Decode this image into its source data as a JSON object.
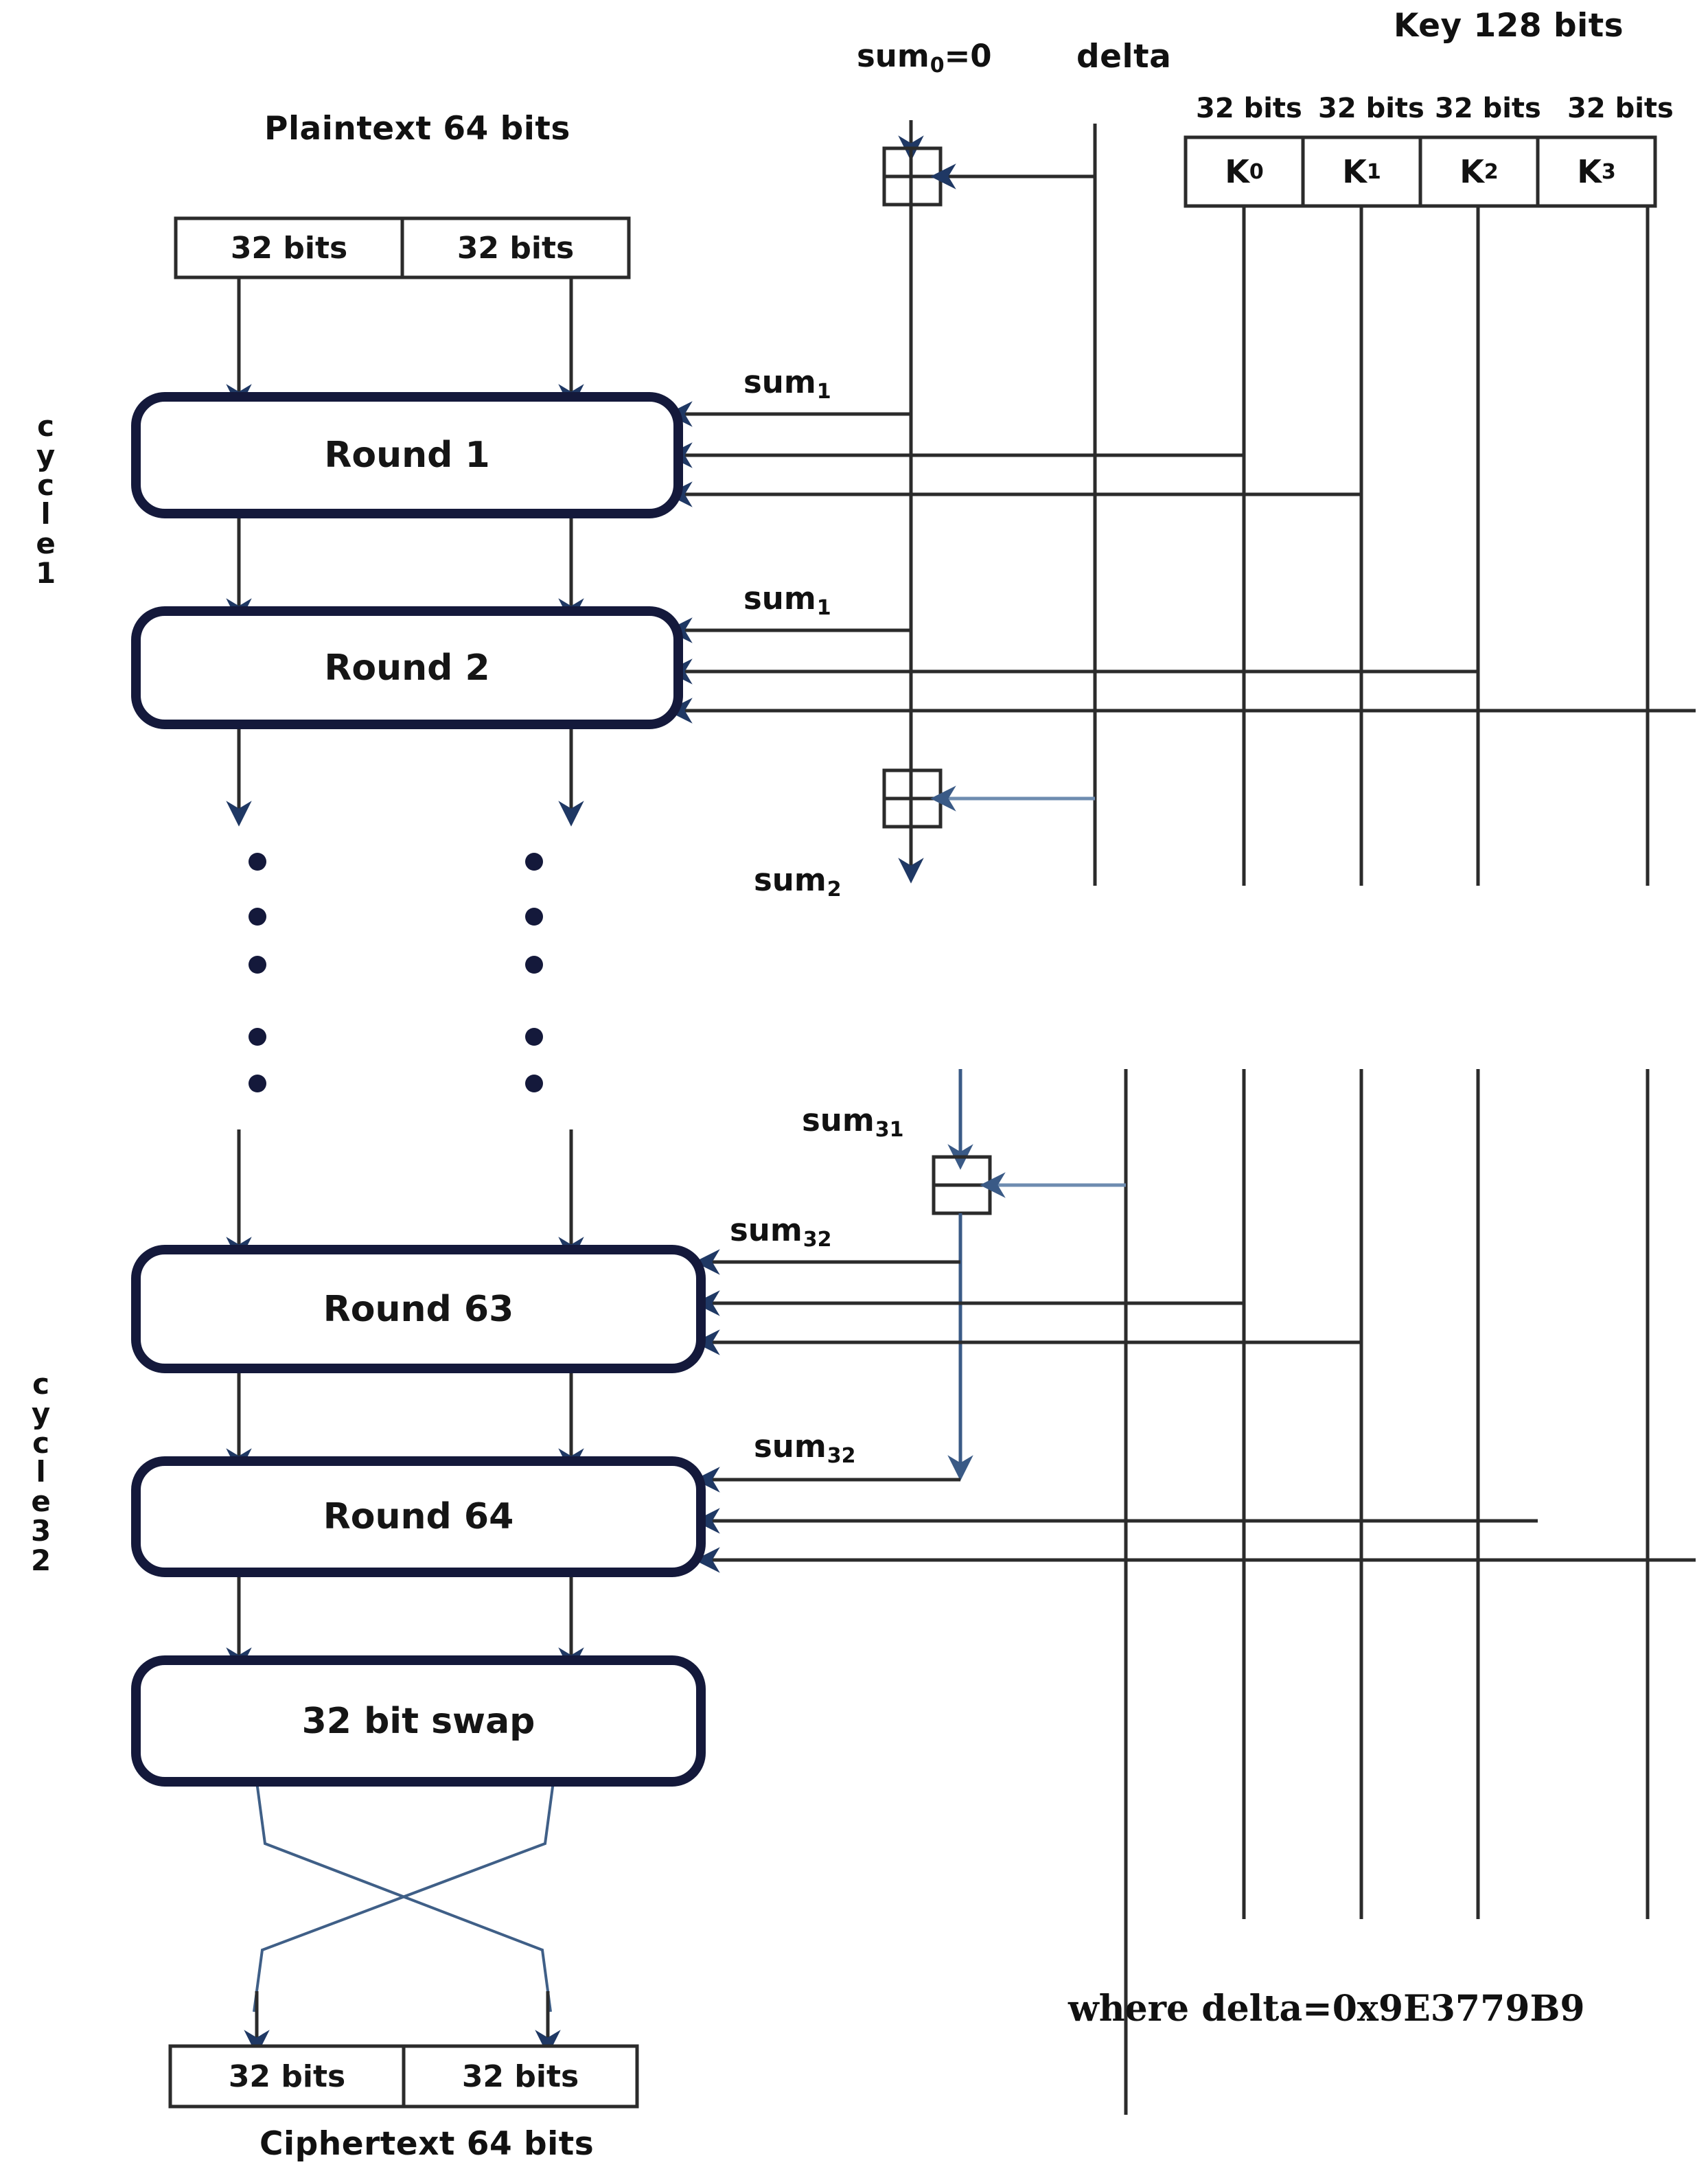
{
  "diagram": {
    "title_plaintext": "Plaintext 64 bits",
    "title_ciphertext": "Ciphertext 64 bits",
    "title_key": "Key 128 bits",
    "label_delta": "delta",
    "label_sum0": "sum",
    "label_sum0_sub": "0",
    "label_sum0_eq": "=0",
    "note_delta_value": "where delta=0x9E3779B9",
    "cycle_first": "cycle 1",
    "cycle_last": "cycle 32",
    "cycle_first_chars": [
      "c",
      "y",
      "c",
      "l",
      "e",
      "1"
    ],
    "cycle_last_chars": [
      "c",
      "y",
      "c",
      "l",
      "e",
      "3",
      "2"
    ],
    "plaintext_halves": [
      "32 bits",
      "32 bits"
    ],
    "ciphertext_halves": [
      "32 bits",
      "32 bits"
    ],
    "key_widths": [
      "32 bits",
      "32 bits",
      "32 bits",
      "32 bits"
    ],
    "key_cells": [
      {
        "base": "K",
        "sub": "0"
      },
      {
        "base": "K",
        "sub": "1"
      },
      {
        "base": "K",
        "sub": "2"
      },
      {
        "base": "K",
        "sub": "3"
      }
    ],
    "rounds": [
      {
        "label": "Round 1"
      },
      {
        "label": "Round 2"
      },
      {
        "label": "Round 63"
      },
      {
        "label": "Round 64"
      }
    ],
    "swap_label": "32 bit swap",
    "sum_labels": [
      {
        "base": "sum",
        "sub": "1"
      },
      {
        "base": "sum",
        "sub": "1"
      },
      {
        "base": "sum",
        "sub": "2"
      },
      {
        "base": "sum",
        "sub": "31"
      },
      {
        "base": "sum",
        "sub": "32"
      },
      {
        "base": "sum",
        "sub": "32"
      }
    ],
    "colors": {
      "round_border": "#14193b",
      "line_dark": "#2b2b2b",
      "line_blue": "#4a6d96",
      "arrow_blue": "#1f3864",
      "text": "#111111",
      "background": "#ffffff"
    },
    "ellipsis_dot_count": 5
  }
}
